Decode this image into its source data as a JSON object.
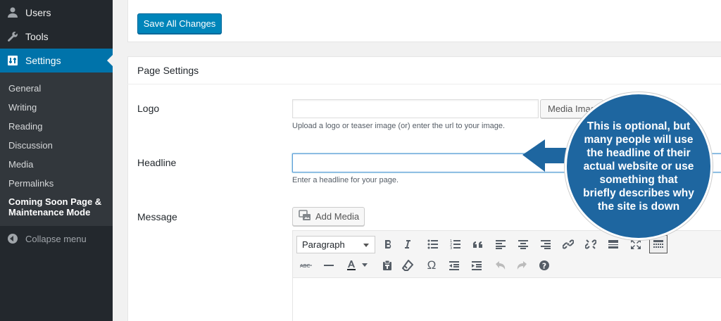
{
  "sidebar": {
    "menu": [
      {
        "label": "Users",
        "icon": "users-icon"
      },
      {
        "label": "Tools",
        "icon": "wrench-icon"
      },
      {
        "label": "Settings",
        "icon": "settings-icon",
        "active": true
      }
    ],
    "submenu": [
      "General",
      "Writing",
      "Reading",
      "Discussion",
      "Media",
      "Permalinks"
    ],
    "current_submenu": [
      "Coming Soon Page &",
      "Maintenance Mode"
    ],
    "collapse_label": "Collapse menu"
  },
  "toolbar": {
    "save_label": "Save All Changes"
  },
  "panel": {
    "title": "Page Settings",
    "logo": {
      "label": "Logo",
      "value": "",
      "button": "Media Image",
      "description": "Upload a logo or teaser image (or) enter the url to your image."
    },
    "headline": {
      "label": "Headline",
      "value": "",
      "description": "Enter a headline for your page."
    },
    "message": {
      "label": "Message",
      "add_media": "Add Media",
      "format": "Paragraph"
    }
  },
  "editor_buttons": {
    "row1": [
      "bold-icon",
      "italic-icon",
      "bullet-list-icon",
      "numbered-list-icon",
      "blockquote-icon",
      "align-left-icon",
      "align-center-icon",
      "align-right-icon",
      "link-icon",
      "unlink-icon",
      "read-more-icon",
      "fullscreen-icon",
      "toolbar-toggle-icon"
    ],
    "row2": [
      "strikethrough-icon",
      "horizontal-line-icon",
      "text-color-icon",
      "paste-text-icon",
      "clear-formatting-icon",
      "special-character-icon",
      "outdent-icon",
      "indent-icon",
      "undo-icon",
      "redo-icon",
      "help-icon"
    ]
  },
  "callout": {
    "text": "This is optional, but many people will use the headline of their actual website or use something that briefly describes why the site is down",
    "color": "#1e66a0"
  },
  "colors": {
    "accent": "#0073aa",
    "sidebar": "#23282d",
    "button": "#0085ba"
  }
}
